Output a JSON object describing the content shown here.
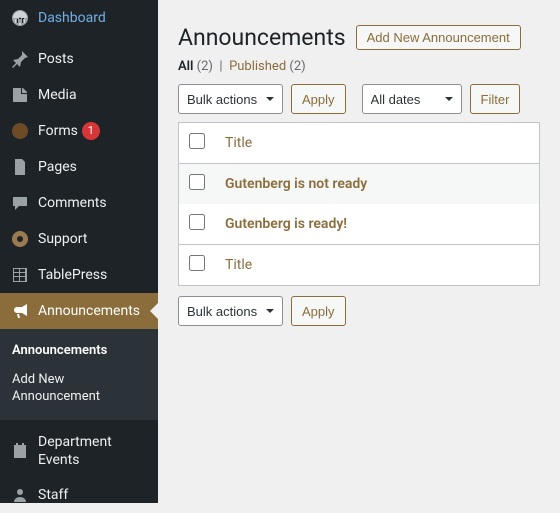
{
  "sidebar": {
    "items": [
      {
        "icon": "dashboard",
        "label": "Dashboard"
      },
      {
        "icon": "pin",
        "label": "Posts"
      },
      {
        "icon": "media",
        "label": "Media"
      },
      {
        "icon": "forms",
        "label": "Forms",
        "badge": "1"
      },
      {
        "icon": "page",
        "label": "Pages"
      },
      {
        "icon": "comment",
        "label": "Comments"
      },
      {
        "icon": "support",
        "label": "Support"
      },
      {
        "icon": "table",
        "label": "TablePress"
      },
      {
        "icon": "megaphone",
        "label": "Announcements",
        "active": true
      },
      {
        "icon": "calendar",
        "label": "Department Events"
      },
      {
        "icon": "user",
        "label": "Staff"
      }
    ],
    "submenu": {
      "items": [
        "Announcements",
        "Add New Announcement"
      ],
      "current": 0
    }
  },
  "page": {
    "title": "Announcements",
    "add_button": "Add New Announcement"
  },
  "filters": {
    "all_label": "All",
    "all_count": "(2)",
    "published_label": "Published",
    "published_count": "(2)",
    "separator": "|"
  },
  "top_nav": {
    "bulk": "Bulk actions",
    "apply": "Apply",
    "dates": "All dates",
    "filter": "Filter"
  },
  "table": {
    "header": {
      "title": "Title"
    },
    "rows": [
      {
        "title": "Gutenberg is not ready"
      },
      {
        "title": "Gutenberg is ready!"
      }
    ],
    "footer": {
      "title": "Title"
    }
  },
  "bottom_nav": {
    "bulk": "Bulk actions",
    "apply": "Apply"
  }
}
